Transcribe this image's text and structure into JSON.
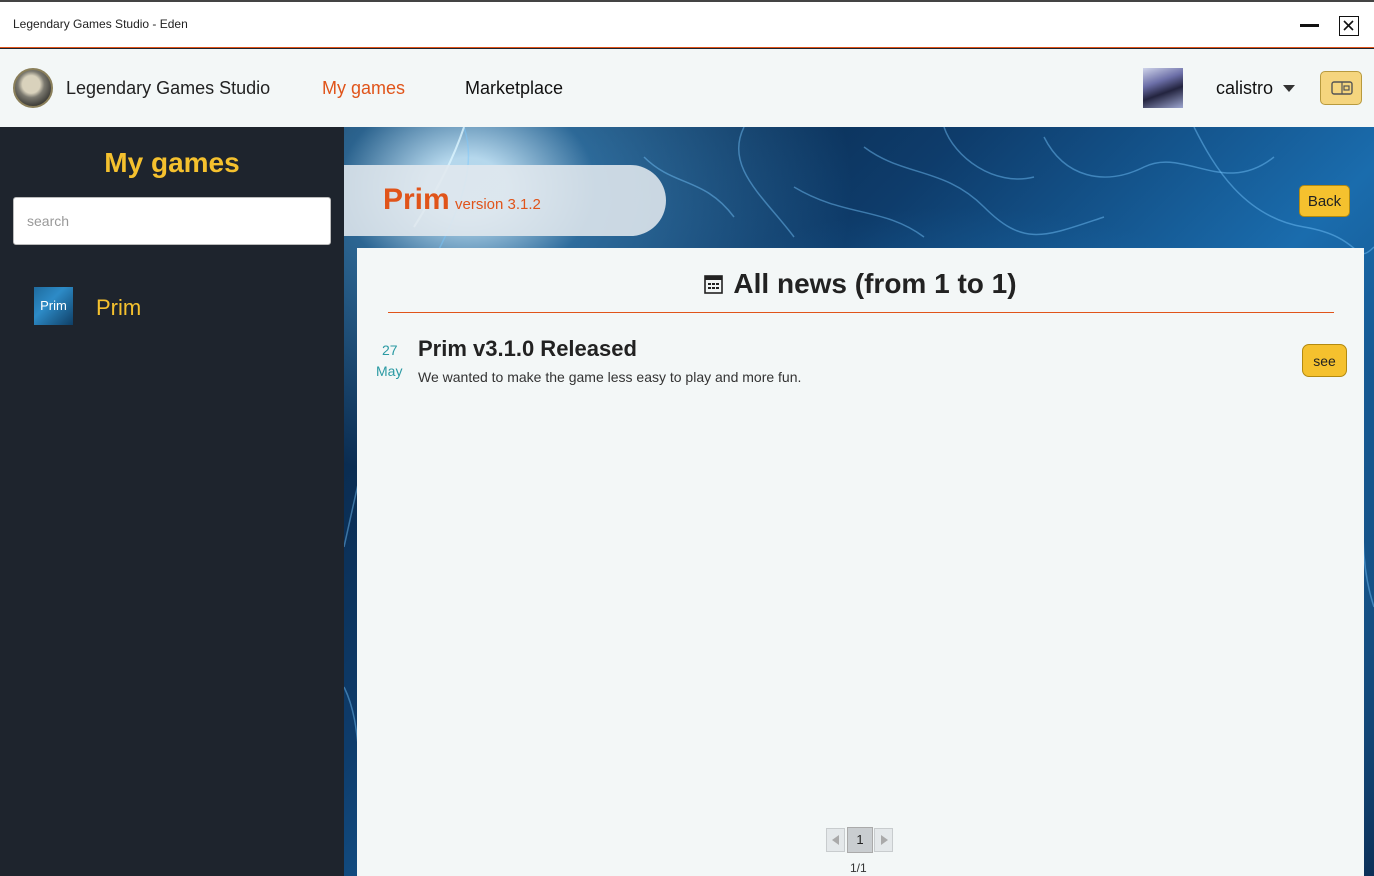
{
  "window": {
    "title": "Legendary Games Studio - Eden"
  },
  "navbar": {
    "brand": "Legendary Games Studio",
    "links": [
      "My games",
      "Marketplace"
    ],
    "username": "calistro"
  },
  "sidebar": {
    "title": "My games",
    "search_placeholder": "search",
    "games": [
      {
        "thumb_label": "Prim",
        "label": "Prim"
      }
    ]
  },
  "main": {
    "game_name": "Prim",
    "version_label": "version  3.1.2",
    "back_label": "Back",
    "news_heading": "All news (from 1 to 1)",
    "news": [
      {
        "day": "27",
        "month": "May",
        "title": "Prim v3.1.0 Released",
        "description": "We wanted to make the game less easy to play and more fun.",
        "action_label": "see"
      }
    ],
    "pagination": {
      "current_page": "1",
      "page_count": "1/1"
    }
  },
  "colors": {
    "accent": "#e0541a",
    "highlight": "#f5c12e",
    "sidebar_bg": "#1e242d",
    "panel_bg": "#f3f7f7",
    "date": "#2a9aa3"
  },
  "icons": [
    "close-icon",
    "minimize-icon",
    "caret-down-icon",
    "wallet-icon",
    "calendar-icon",
    "prev-page-icon",
    "next-page-icon"
  ]
}
